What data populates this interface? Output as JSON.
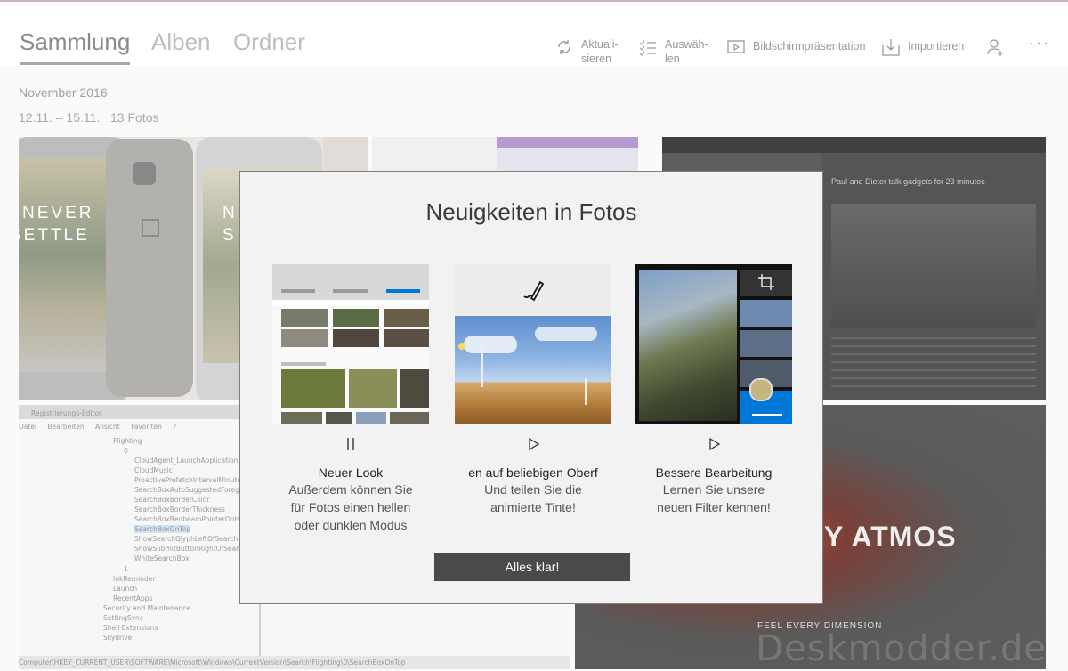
{
  "tabs": [
    {
      "label": "Sammlung",
      "active": true
    },
    {
      "label": "Alben",
      "active": false
    },
    {
      "label": "Ordner",
      "active": false
    }
  ],
  "toolbar": {
    "refresh_label_1": "Aktuali-",
    "refresh_label_2": "sieren",
    "select_label_1": "Auswäh-",
    "select_label_2": "len",
    "slideshow_label": "Bildschirmpräsentation",
    "import_label": "Importieren",
    "add_person_icon": "person-add-icon",
    "more_icon": "more-icon"
  },
  "collection": {
    "month": "November 2016",
    "range": "12.11. – 15.11.",
    "count": "13 Fotos"
  },
  "background_photos": {
    "phone_text_1": "NEVER",
    "phone_text_2": "SETTLE",
    "article_title": "Paul and Dieter talk gadgets for 23 minutes",
    "atmos_text": "Y ATMOS",
    "atmos_sub": "FEEL EVERY DIMENSION",
    "regedit_title": "Registrierungs-Editor",
    "regedit_menu": [
      "Datei",
      "Bearbeiten",
      "Ansicht",
      "Favoriten",
      "?"
    ],
    "regedit_items": [
      "Flighting",
      "0",
      "CloudAgent_LaunchApplication",
      "CloudMusic",
      "ProactivePrefetchIntervalMinutes",
      "SearchBoxAutoSuggestedForegroun",
      "SearchBoxBorderColor",
      "SearchBoxBorderThickness",
      "SearchBoxBedbeamPointerOnHover",
      "SearchBoxOnTop",
      "ShowSearchGlyphLeftOfSearchBox",
      "ShowSubmitButtonRightOfSearchBo",
      "WhiteSearchBox",
      "1",
      "InkReminder",
      "Launch",
      "RecentApps",
      "Security and Maintenance",
      "SettingSync",
      "Shell Extensions",
      "Skydrive"
    ],
    "regedit_path": "Computer\\HKEY_CURRENT_USER\\SOFTWARE\\Microsoft\\Windows\\CurrentVersion\\Search\\Flighting\\0\\SearchBoxOnTop"
  },
  "watermark": "Deskmodder.de",
  "dialog": {
    "title": "Neuigkeiten in Fotos",
    "features": [
      {
        "title": "Neuer Look",
        "desc_1": "Außerdem können Sie",
        "desc_2": "für Fotos einen hellen",
        "desc_3": "oder dunklen Modus",
        "control_icon": "pause-icon"
      },
      {
        "title": "en auf beliebigen Oberf",
        "desc_1": "Und teilen Sie die",
        "desc_2": "animierte Tinte!",
        "desc_3": "",
        "control_icon": "play-icon"
      },
      {
        "title": "Bessere Bearbeitung",
        "desc_1": "Lernen Sie unsere",
        "desc_2": "neuen Filter kennen!",
        "desc_3": "",
        "control_icon": "play-icon"
      }
    ],
    "ok_label": "Alles klar!"
  },
  "colors": {
    "accent": "#0078d7",
    "button": "#4a4a4a",
    "dialog_bg": "#f2f2f2"
  }
}
